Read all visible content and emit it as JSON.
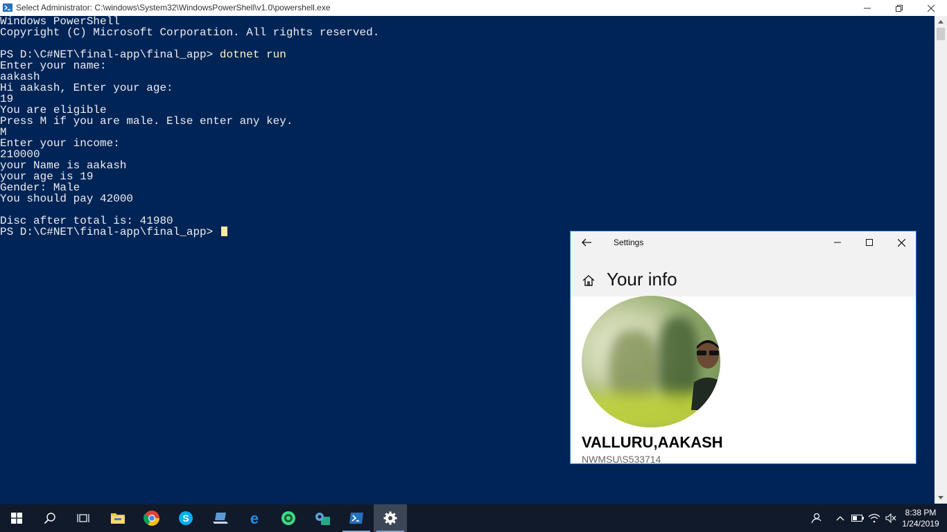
{
  "powershell": {
    "title": "Select Administrator: C:\\windows\\System32\\WindowsPowerShell\\v1.0\\powershell.exe",
    "lines": [
      {
        "text": "Windows PowerShell"
      },
      {
        "text": "Copyright (C) Microsoft Corporation. All rights reserved."
      },
      {
        "text": ""
      },
      {
        "prompt": "PS D:\\C#NET\\final-app\\final_app> ",
        "cmd": "dotnet run"
      },
      {
        "text": "Enter your name:"
      },
      {
        "text": "aakash"
      },
      {
        "text": "Hi aakash, Enter your age:"
      },
      {
        "text": "19"
      },
      {
        "text": "You are eligible"
      },
      {
        "text": "Press M if you are male. Else enter any key."
      },
      {
        "text": "M"
      },
      {
        "text": "Enter your income:"
      },
      {
        "text": "210000"
      },
      {
        "text": "your Name is aakash"
      },
      {
        "text": "your age is 19"
      },
      {
        "text": "Gender: Male"
      },
      {
        "text": "You should pay 42000"
      },
      {
        "text": ""
      },
      {
        "text": "Disc after total is: 41980"
      },
      {
        "prompt": "PS D:\\C#NET\\final-app\\final_app> ",
        "cmd": "",
        "cursor": true
      }
    ]
  },
  "settings": {
    "title": "Settings",
    "page_title": "Your info",
    "user_name": "VALLURU,AAKASH",
    "account": "NWMSU\\S533714"
  },
  "taskbar": {
    "items": [
      {
        "name": "start-button",
        "icon": "windows-logo-icon"
      },
      {
        "name": "search-button",
        "icon": "search-icon"
      },
      {
        "name": "task-view-button",
        "icon": "task-view-icon"
      },
      {
        "name": "file-explorer",
        "icon": "folder-icon"
      },
      {
        "name": "chrome",
        "icon": "chrome-icon"
      },
      {
        "name": "skype",
        "icon": "skype-icon"
      },
      {
        "name": "app-laptop",
        "icon": "laptop-icon"
      },
      {
        "name": "edge",
        "icon": "edge-icon"
      },
      {
        "name": "android-studio",
        "icon": "android-icon"
      },
      {
        "name": "app-tools",
        "icon": "tools-icon"
      },
      {
        "name": "powershell",
        "icon": "powershell-icon"
      },
      {
        "name": "settings",
        "icon": "gear-icon"
      }
    ],
    "clock_time": "8:38 PM",
    "clock_date": "1/24/2019"
  },
  "colors": {
    "console_bg": "#012456",
    "console_text": "#eeedf0",
    "command_text": "#fdf6c7",
    "taskbar_bg": "#101a2b",
    "accent": "#1e7ad4"
  }
}
